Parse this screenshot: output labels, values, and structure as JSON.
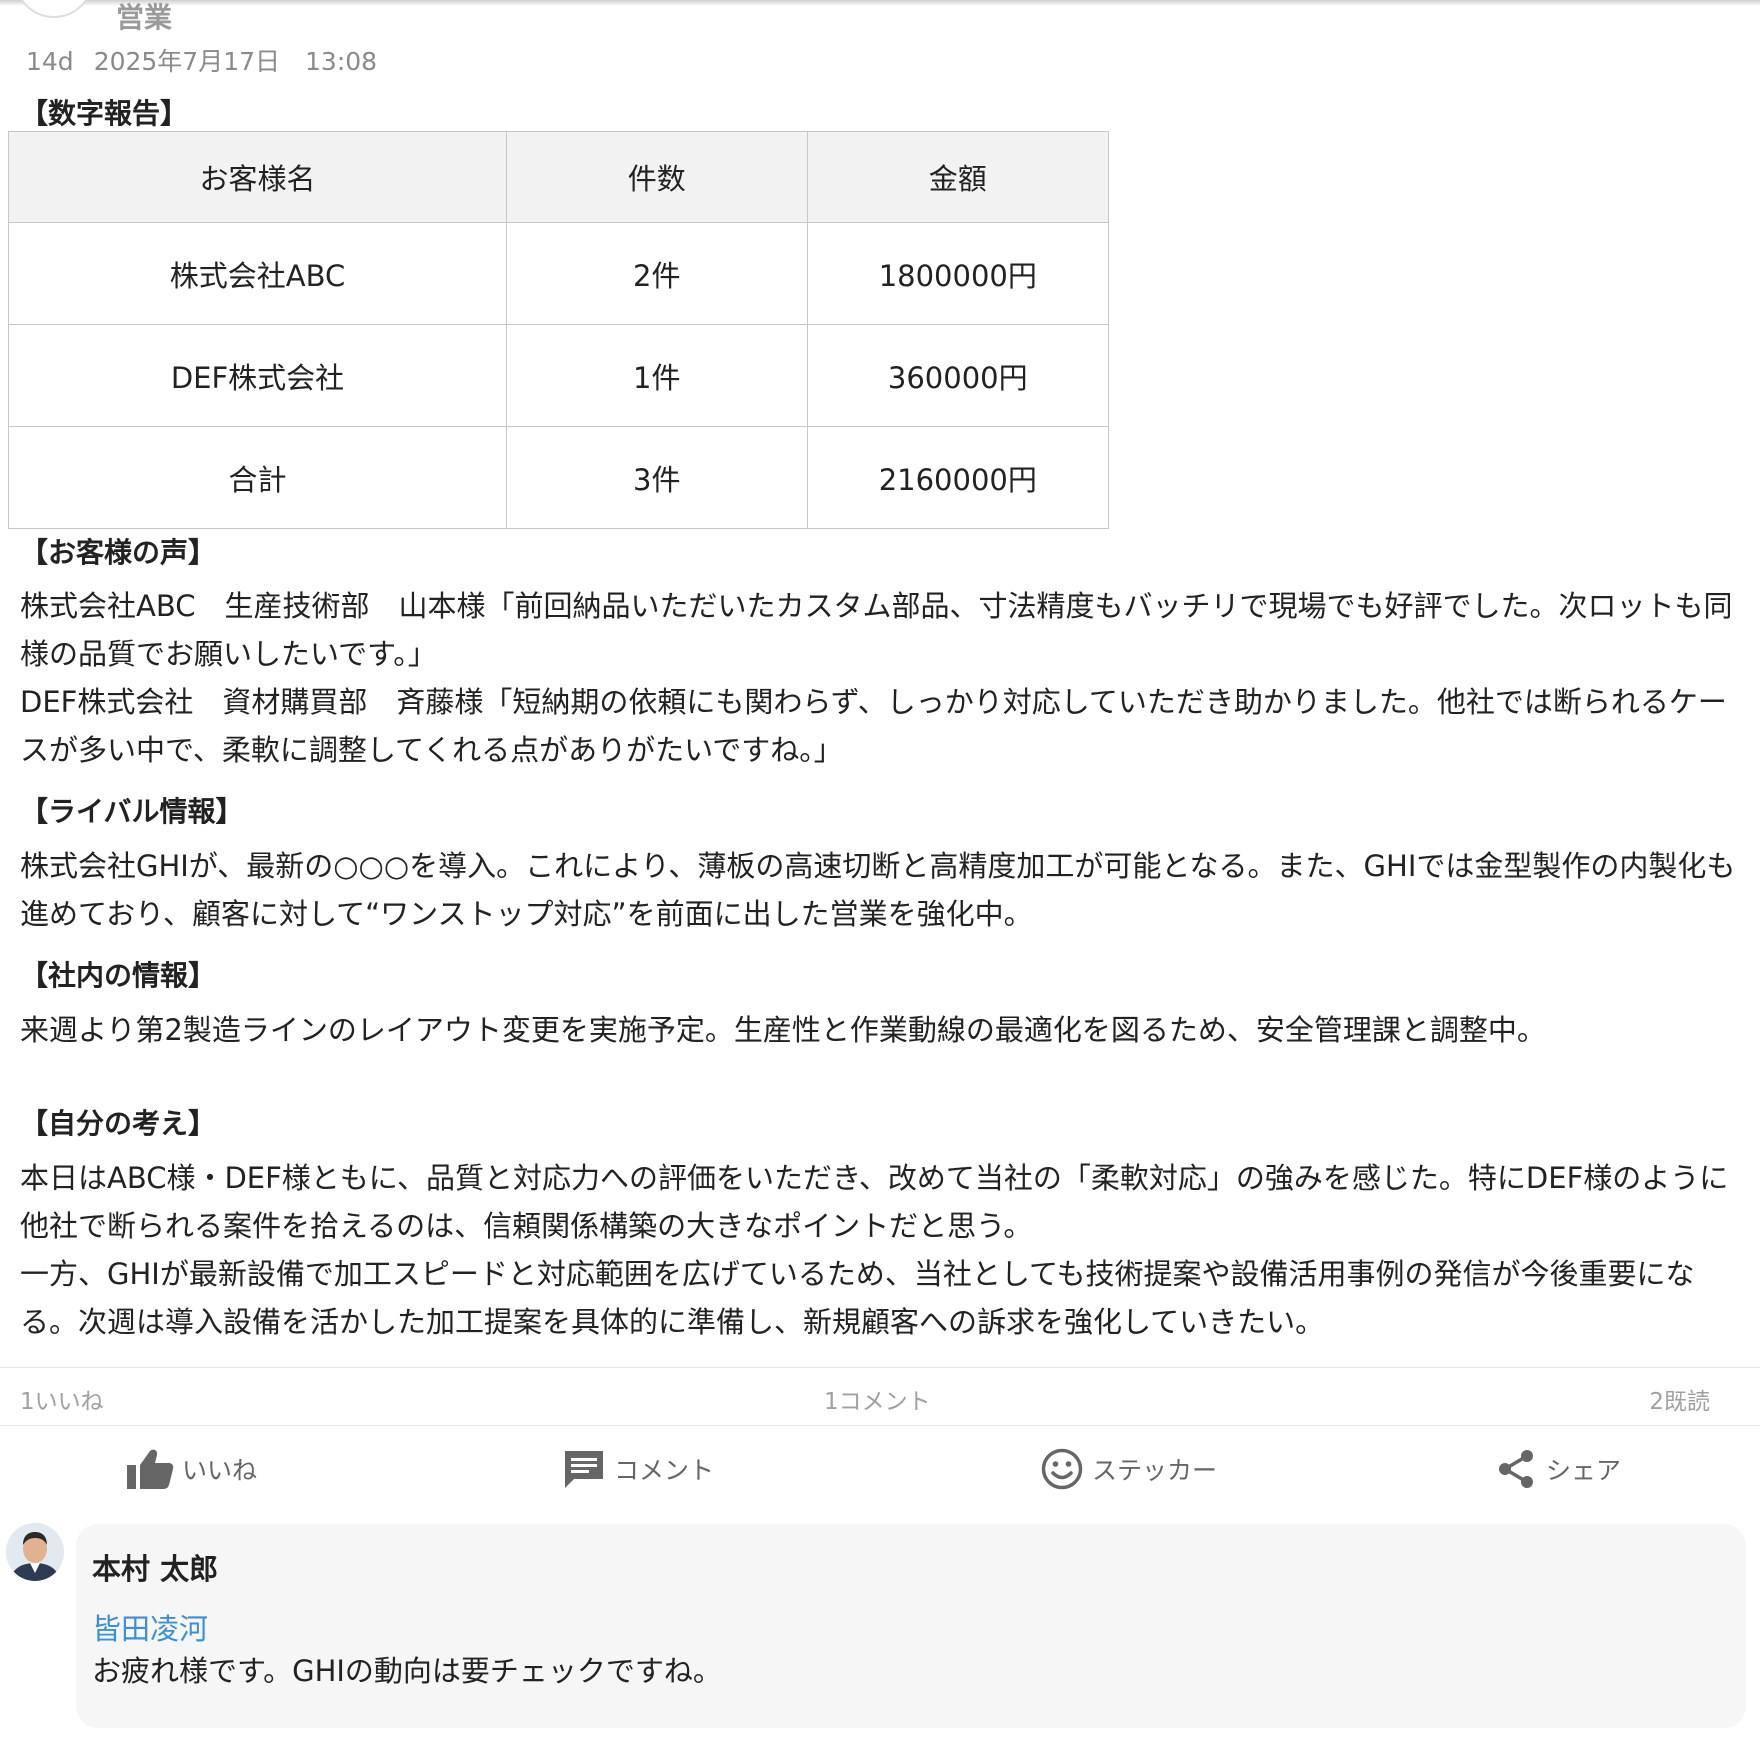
{
  "post": {
    "group_name": "営業",
    "age": "14d",
    "datetime": "2025年7月17日　13:08"
  },
  "sections": {
    "numbers": "【数字報告】",
    "voice": "【お客様の声】",
    "rival": "【ライバル情報】",
    "internal": "【社内の情報】",
    "thoughts": "【自分の考え】"
  },
  "table": {
    "headers": [
      "お客様名",
      "件数",
      "金額"
    ],
    "rows": [
      [
        "株式会社ABC",
        "2件",
        "1800000円"
      ],
      [
        "DEF株式会社",
        "1件",
        "360000円"
      ],
      [
        "合計",
        "3件",
        "2160000円"
      ]
    ]
  },
  "voice_paragraphs": [
    "株式会社ABC　生産技術部　山本様「前回納品いただいたカスタム部品、寸法精度もバッチリで現場でも好評でした。次ロットも同様の品質でお願いしたいです。」",
    "DEF株式会社　資材購買部　斉藤様「短納期の依頼にも関わらず、しっかり対応していただき助かりました。他社では断られるケースが多い中で、柔軟に調整してくれる点がありがたいですね。」"
  ],
  "rival_text": "株式会社GHIが、最新の○○○を導入。これにより、薄板の高速切断と高精度加工が可能となる。また、GHIでは金型製作の内製化も進めており、顧客に対して“ワンストップ対応”を前面に出した営業を強化中。",
  "internal_text": "来週より第2製造ラインのレイアウト変更を実施予定。生産性と作業動線の最適化を図るため、安全管理課と調整中。",
  "thoughts_paragraphs": [
    "本日はABC様・DEF様ともに、品質と対応力への評価をいただき、改めて当社の「柔軟対応」の強みを感じた。特にDEF様のように他社で断られる案件を拾えるのは、信頼関係構築の大きなポイントだと思う。",
    "一方、GHIが最新設備で加工スピードと対応範囲を広げているため、当社としても技術提案や設備活用事例の発信が今後重要になる。次週は導入設備を活かした加工提案を具体的に準備し、新規顧客への訴求を強化していきたい。"
  ],
  "stats": {
    "likes": "1いいね",
    "comments": "1コメント",
    "reads": "2既読"
  },
  "actions": {
    "like": "いいね",
    "comment": "コメント",
    "sticker": "ステッカー",
    "share": "シェア"
  },
  "comment": {
    "author": "本村 太郎",
    "mention": "皆田凌河",
    "text": "お疲れ様です。GHIの動向は要チェックですね。"
  },
  "icons": {
    "like": "thumbs-up-icon",
    "comment": "comment-icon",
    "sticker": "smiley-icon",
    "share": "share-icon"
  },
  "colors": {
    "mention": "#3b8fd9",
    "icon": "#666666",
    "meta": "#8a8a8a"
  }
}
